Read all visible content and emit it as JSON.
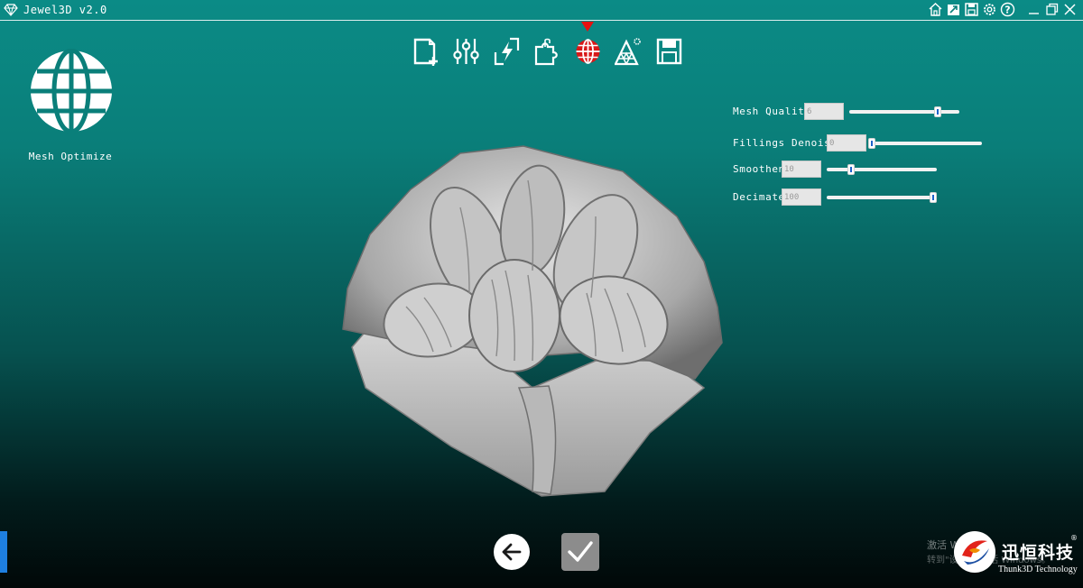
{
  "window": {
    "title": "Jewel3D v2.0",
    "title_icons": [
      "home-icon",
      "export-icon",
      "save-icon",
      "settings-icon",
      "help-icon",
      "minimize-icon",
      "restore-icon",
      "close-icon"
    ]
  },
  "toolbar": {
    "tools": [
      {
        "id": "new-project",
        "icon": "new-file-icon"
      },
      {
        "id": "adjust",
        "icon": "sliders-icon"
      },
      {
        "id": "process",
        "icon": "lightning-icon"
      },
      {
        "id": "plugins",
        "icon": "puzzle-icon"
      },
      {
        "id": "mesh-optimize",
        "icon": "globe-icon",
        "active": true
      },
      {
        "id": "mesh",
        "icon": "triangle-mesh-icon"
      },
      {
        "id": "save",
        "icon": "floppy-icon"
      }
    ],
    "active_color": "#e81010"
  },
  "mode": {
    "label": "Mesh Optimize",
    "icon": "globe-icon"
  },
  "controls": [
    {
      "label": "Mesh Quality",
      "value": "6",
      "level": 0.8
    },
    {
      "label": "Fillings Denoise",
      "value": "0",
      "level": 0.0
    },
    {
      "label": "Smoothen",
      "value": "10",
      "level": 0.22
    },
    {
      "label": "Decimate",
      "value": "100",
      "level": 1.0
    }
  ],
  "viewport": {
    "model": "flower-model"
  },
  "actions": {
    "back_icon": "arrow-left-icon",
    "confirm_icon": "checkmark-icon"
  },
  "watermark": {
    "line1": "激活 Windows",
    "line2": "转到\"设置\"以激活 Windows。"
  },
  "brand": {
    "cn": "迅恒科技",
    "reg": "®",
    "en": "Thunk3D Technology"
  },
  "colors": {
    "background_top": "#0b8b86",
    "background_bottom": "#010808",
    "slider_thumb_accent": "#1d62c9",
    "left_tab": "#1e7fe0"
  }
}
